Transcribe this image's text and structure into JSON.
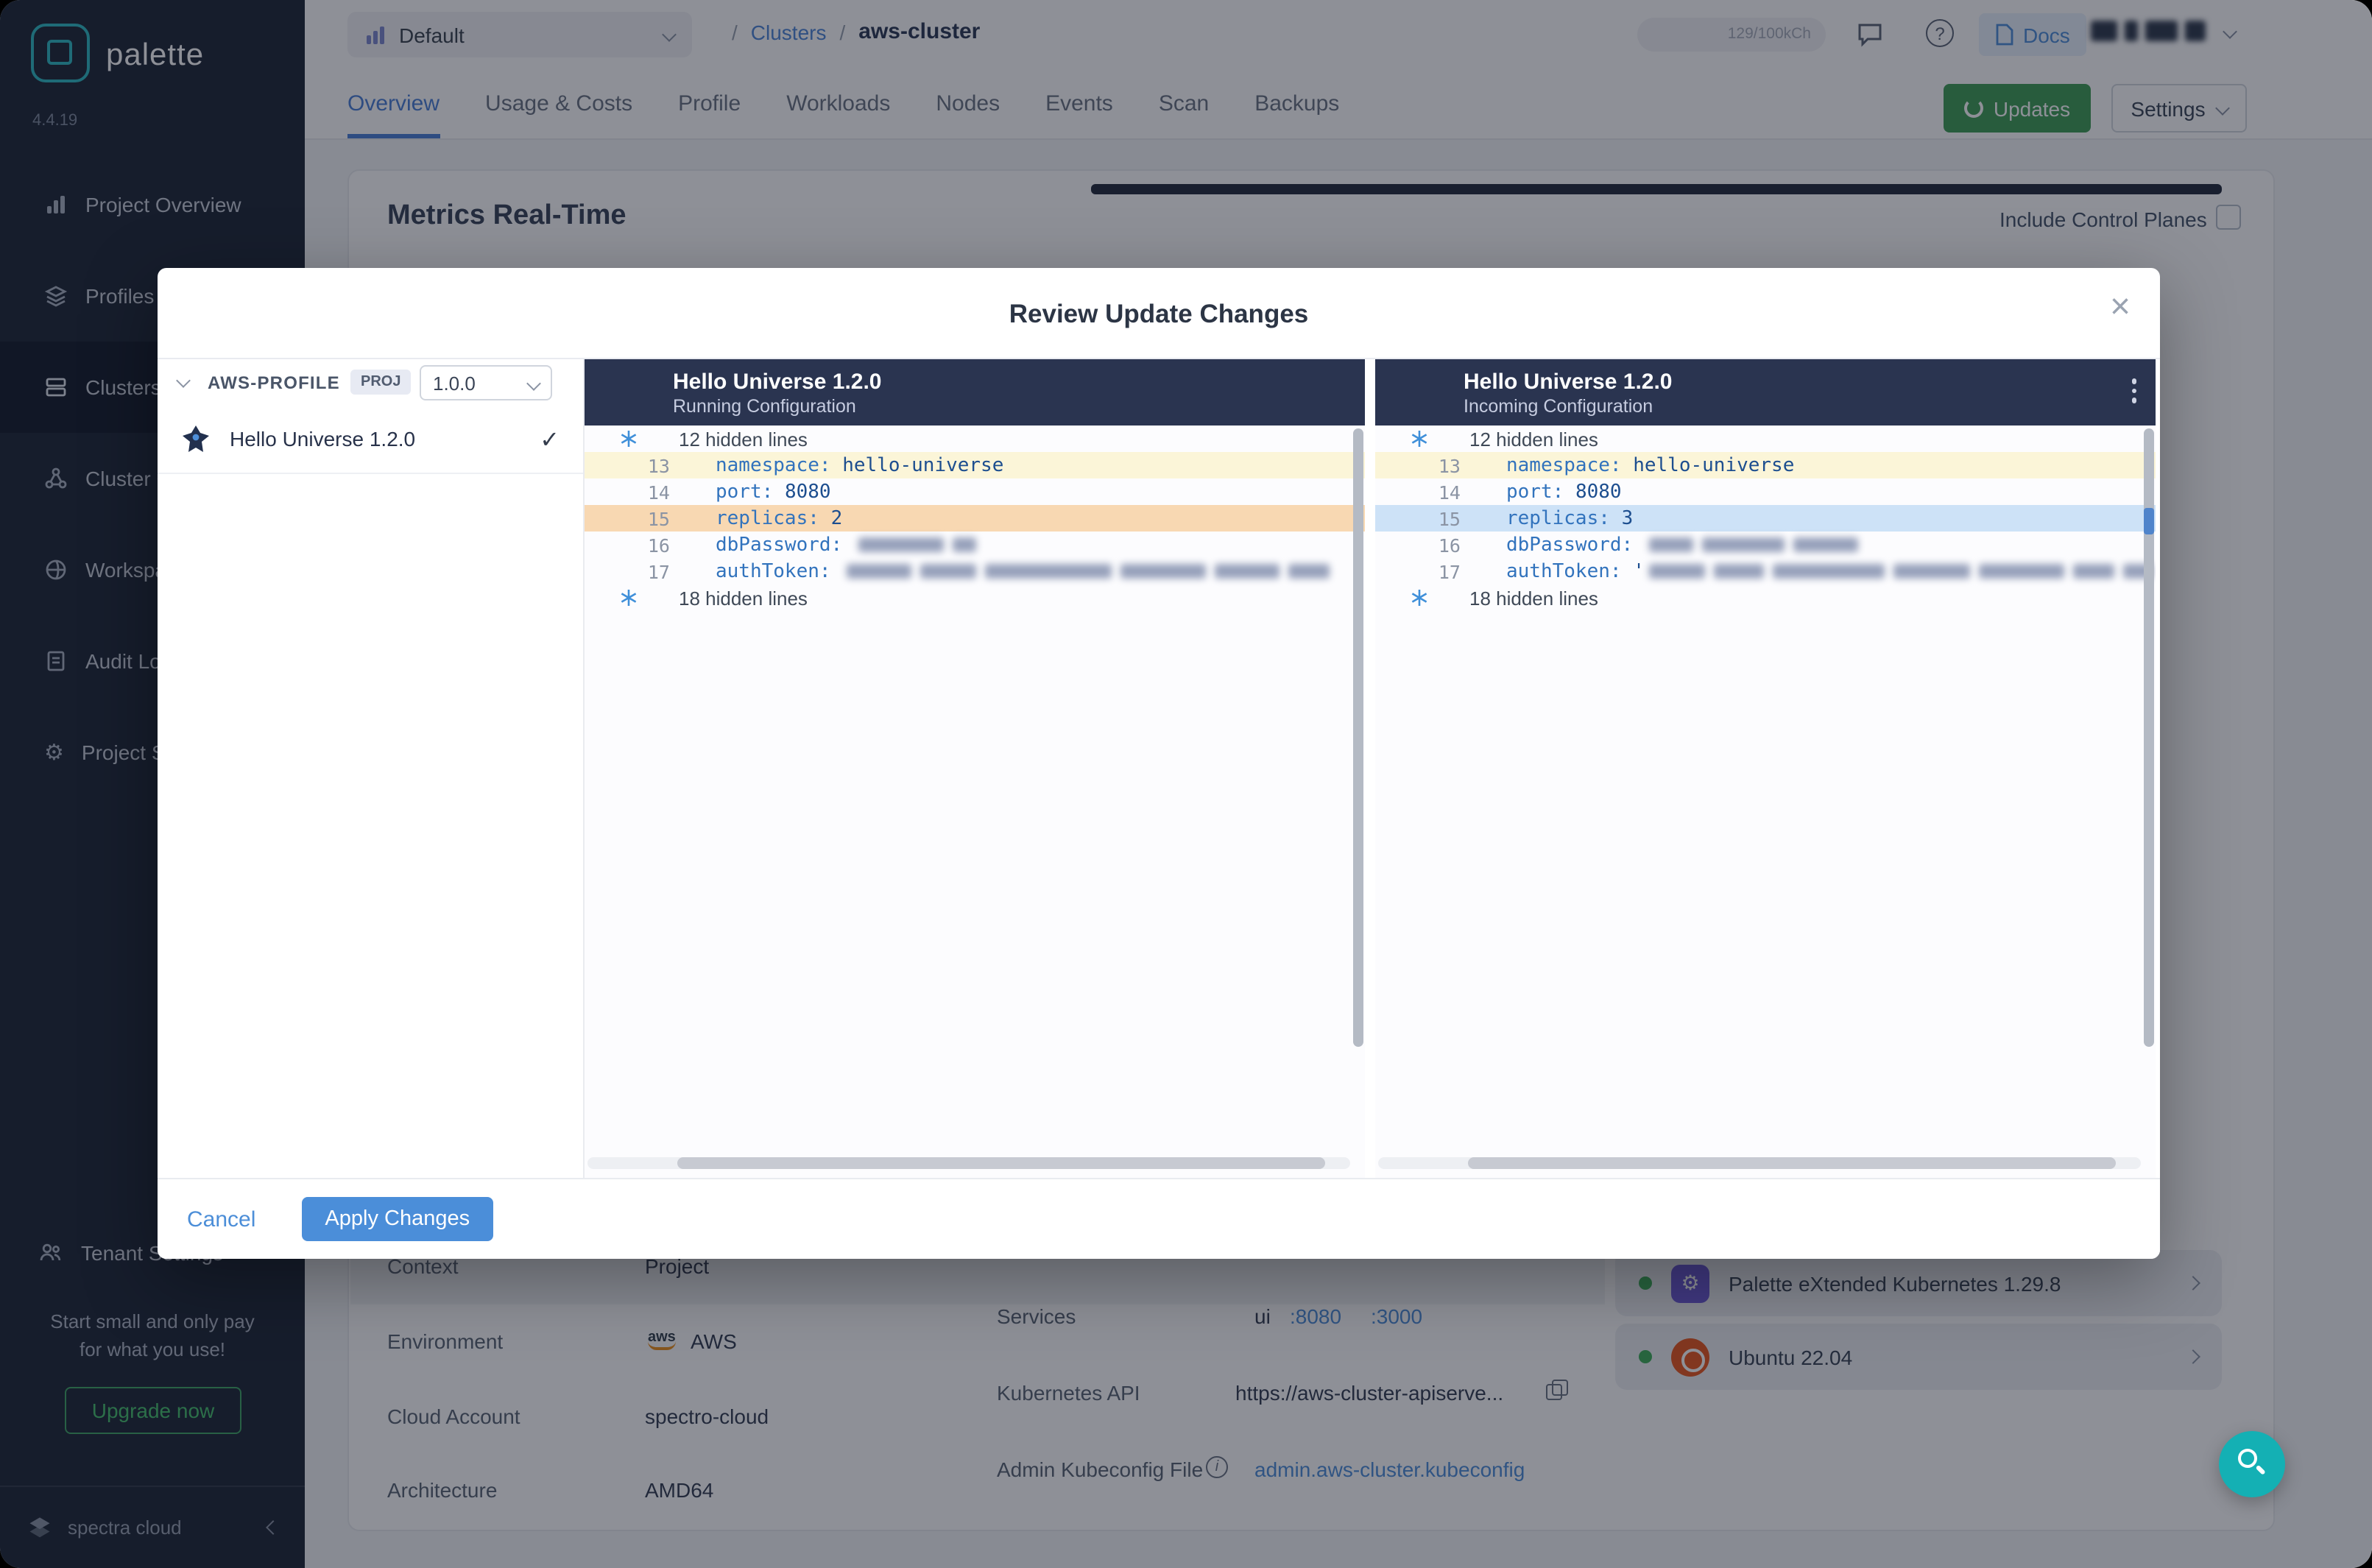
{
  "colors": {
    "accent_blue": "#4a8ed8",
    "brand_teal": "#2fb9c3",
    "success_green": "#3fae5a",
    "header_navy": "#2a3450",
    "diff_changed_bg": "#fbf5d8",
    "diff_removed_bg": "#f8d8b2",
    "diff_added_bg": "#cde2f7",
    "fab_teal": "#14b0b4"
  },
  "icons": {
    "close": "×",
    "check": "✓",
    "gear": "⚙",
    "info": "i"
  },
  "sidebar": {
    "brand": "palette",
    "version": "4.4.19",
    "items": [
      {
        "label": "Project Overview"
      },
      {
        "label": "Profiles"
      },
      {
        "label": "Clusters"
      },
      {
        "label": "Cluster Groups"
      },
      {
        "label": "Workspaces"
      },
      {
        "label": "Audit Logs"
      },
      {
        "label": "Project Settings"
      }
    ],
    "tenant_settings": "Tenant Settings",
    "promo": {
      "line1": "Start small and only pay",
      "line2": "for what you use!"
    },
    "upgrade_button": "Upgrade now",
    "footer_brand": "spectra cloud"
  },
  "topbar": {
    "project_selector": "Default",
    "breadcrumb": {
      "separator": "/",
      "parent": "Clusters",
      "current": "aws-cluster"
    },
    "usage_badge": "129/100kCh",
    "docs_label": "Docs"
  },
  "tabs": {
    "items": [
      "Overview",
      "Usage & Costs",
      "Profile",
      "Workloads",
      "Nodes",
      "Events",
      "Scan",
      "Backups"
    ],
    "active_tab": "Overview",
    "updates_button": "Updates",
    "settings_button": "Settings"
  },
  "metrics": {
    "title": "Metrics Real-Time",
    "include_control_planes_label": "Include Control Planes",
    "include_control_planes_checked": false
  },
  "details": {
    "rows": [
      {
        "label": "Context",
        "value": "Project"
      },
      {
        "label": "Environment",
        "value": "AWS"
      },
      {
        "label": "Cloud Account",
        "value": "spectro-cloud"
      },
      {
        "label": "Architecture",
        "value": "AMD64"
      }
    ],
    "services": {
      "label": "Services",
      "name": "ui",
      "ports": [
        ":8080",
        ":3000"
      ]
    },
    "kubernetes_api": {
      "label": "Kubernetes API",
      "value": "https://aws-cluster-apiserve..."
    },
    "kubeconfig": {
      "label": "Admin Kubeconfig File",
      "value": "admin.aws-cluster.kubeconfig"
    },
    "stack": [
      {
        "name": "Palette eXtended Kubernetes 1.29.8"
      },
      {
        "name": "Ubuntu 22.04"
      }
    ]
  },
  "modal": {
    "title": "Review Update Changes",
    "profile": {
      "name": "AWS-PROFILE",
      "scope_badge": "PROJ",
      "version": "1.0.0",
      "pack_name": "Hello Universe 1.2.0"
    },
    "left_pane": {
      "title": "Hello Universe 1.2.0",
      "subtitle": "Running Configuration"
    },
    "right_pane": {
      "title": "Hello Universe 1.2.0",
      "subtitle": "Incoming Configuration"
    },
    "diff": {
      "hidden_top": "12 hidden lines",
      "hidden_bottom": "18 hidden lines",
      "left": [
        {
          "num": "13",
          "key": "namespace:",
          "value": "hello-universe"
        },
        {
          "num": "14",
          "key": "port:",
          "value": "8080"
        },
        {
          "num": "15",
          "key": "replicas:",
          "value": "2"
        },
        {
          "num": "16",
          "key": "dbPassword:",
          "value": ""
        },
        {
          "num": "17",
          "key": "authToken:",
          "value": ""
        }
      ],
      "right": [
        {
          "num": "13",
          "key": "namespace:",
          "value": "hello-universe"
        },
        {
          "num": "14",
          "key": "port:",
          "value": "8080"
        },
        {
          "num": "15",
          "key": "replicas:",
          "value": "3"
        },
        {
          "num": "16",
          "key": "dbPassword:",
          "value": ""
        },
        {
          "num": "17",
          "key": "authToken:",
          "value": "'"
        }
      ]
    },
    "cancel_button": "Cancel",
    "apply_button": "Apply Changes"
  }
}
